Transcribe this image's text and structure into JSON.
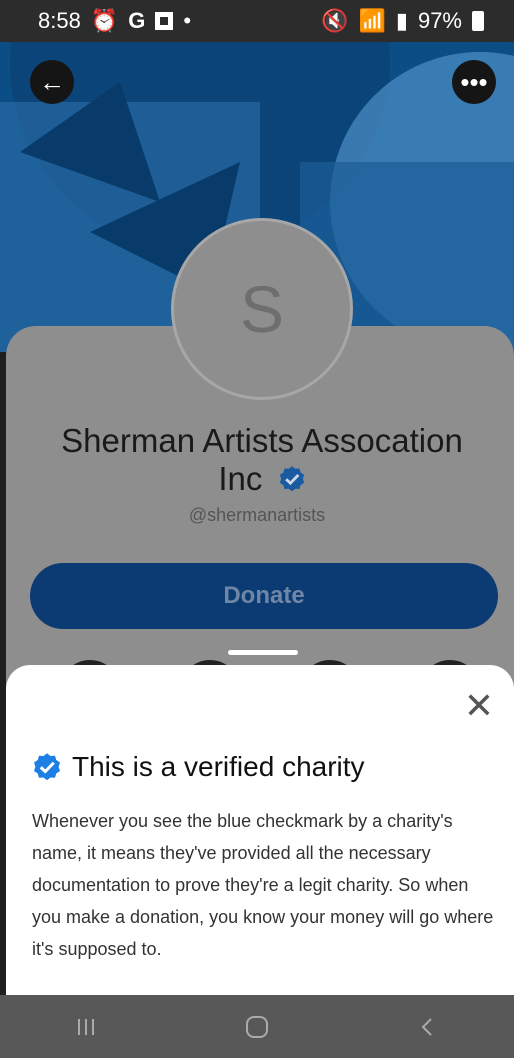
{
  "status_bar": {
    "time": "8:58",
    "left_icons": [
      "alarm-icon",
      "google-g-icon",
      "flipboard-icon",
      "dot-icon"
    ],
    "g_label": "G",
    "right_icons": [
      "mute-icon",
      "wifi-icon",
      "signal-icon"
    ],
    "battery": "97%"
  },
  "header": {
    "back_icon": "arrow-left-icon",
    "more_icon": "more-horizontal-icon"
  },
  "profile": {
    "avatar_letter": "S",
    "name_line1": "Sherman Artists Assocation",
    "name_line2": "Inc",
    "handle": "@shermanartists",
    "donate_label": "Donate"
  },
  "sheet": {
    "close_icon": "close-icon",
    "title": "This is a verified charity",
    "body": "Whenever you see the blue checkmark by a charity's name, it means they've provided all the necessary documentation to prove they're a legit charity. So when you make a donation, you know your money will go where it's supposed to."
  },
  "colors": {
    "brand_blue": "#0b4d85",
    "verified_blue": "#1d7fe3"
  }
}
